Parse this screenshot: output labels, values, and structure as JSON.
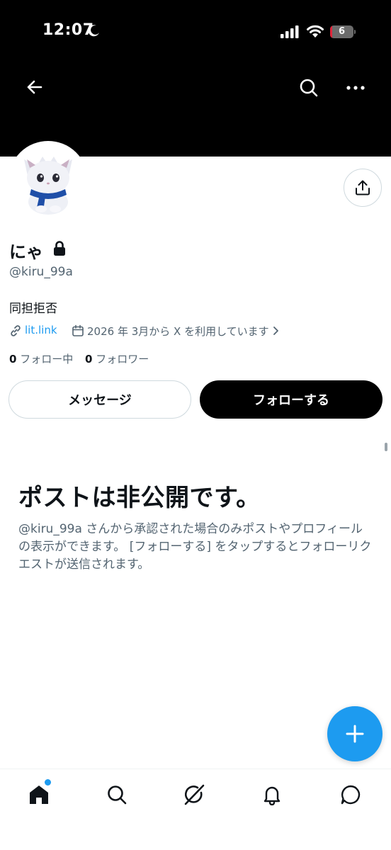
{
  "status_bar": {
    "time": "12:07",
    "battery_level": "6",
    "battery_fraction": 0.06
  },
  "header": {
    "back_icon": "arrow-left-icon",
    "search_icon": "search-icon",
    "more_icon": "more-horizontal-icon"
  },
  "profile": {
    "display_name": "にゃ",
    "protected_icon": "lock-icon",
    "handle": "@kiru_99a",
    "bio": "同担拒否",
    "link": "lit.link",
    "joined": "2026 年 3月から X を利用しています",
    "following_count": "0",
    "following_label": "フォロー中",
    "followers_count": "0",
    "followers_label": "フォロワー",
    "share_icon": "share-icon"
  },
  "actions": {
    "message_label": "メッセージ",
    "follow_label": "フォローする"
  },
  "private_notice": {
    "title": "ポストは非公開です。",
    "description": "@kiru_99a さんから承認された場合のみポストやプロフィールの表示ができます。 [フォローする] をタップするとフォローリクエストが送信されます。"
  },
  "fab": {
    "icon": "plus-icon"
  },
  "bottom_nav": {
    "items": [
      "home-icon",
      "search-icon",
      "grok-icon",
      "notifications-icon",
      "messages-icon"
    ]
  },
  "colors": {
    "accent": "#1d9bf0",
    "text_primary": "#0f1419",
    "text_secondary": "#536471",
    "header_bg": "#000000",
    "battery_low": "#e0243a"
  }
}
